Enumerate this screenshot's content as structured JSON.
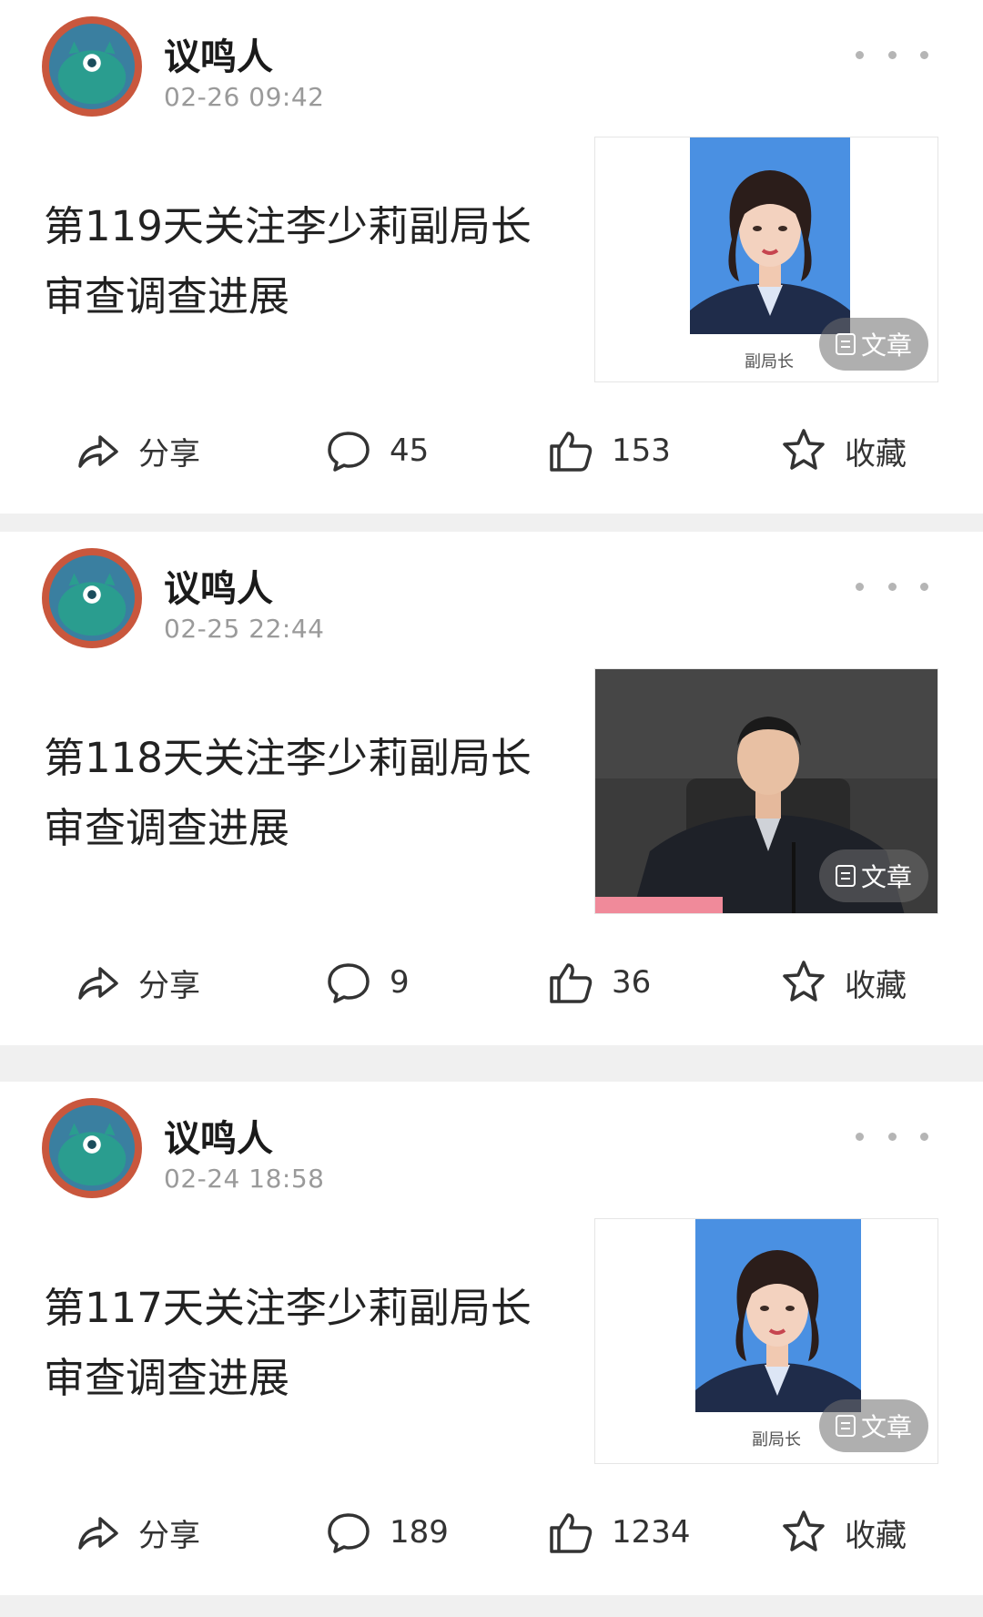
{
  "posts": [
    {
      "author": "议鸣人",
      "time": "02-26 09:42",
      "title_line1": "第119天关注李少莉副局长",
      "title_line2": "审查调查进展",
      "thumb_caption": "副局长",
      "badge": "文章",
      "share_label": "分享",
      "comments": "45",
      "likes": "153",
      "fav_label": "收藏"
    },
    {
      "author": "议鸣人",
      "time": "02-25 22:44",
      "title_line1": "第118天关注李少莉副局长",
      "title_line2": "审查调查进展",
      "badge": "文章",
      "share_label": "分享",
      "comments": "9",
      "likes": "36",
      "fav_label": "收藏"
    },
    {
      "author": "议鸣人",
      "time": "02-24 18:58",
      "title_line1": "第117天关注李少莉副局长",
      "title_line2": "审查调查进展",
      "thumb_caption": "副局长",
      "badge": "文章",
      "share_label": "分享",
      "comments": "189",
      "likes": "1234",
      "fav_label": "收藏"
    }
  ],
  "colors": {
    "avatar_ring": "#c9573d",
    "avatar_fill": "#2a9d8f",
    "id_photo_bg": "#4a90e2",
    "muted_text": "#9a9a9a"
  },
  "icons": {
    "share": "share-arrow-icon",
    "comment": "comment-bubble-icon",
    "like": "thumbs-up-icon",
    "favorite": "star-icon",
    "more": "more-dots-icon",
    "badge": "article-doc-icon"
  }
}
